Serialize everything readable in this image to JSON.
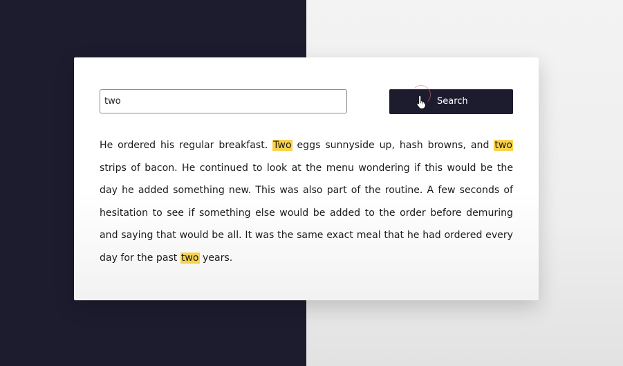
{
  "search": {
    "value": "two",
    "button_label": "Search"
  },
  "paragraph": {
    "segments": [
      {
        "text": "He ordered his regular breakfast. ",
        "highlight": false
      },
      {
        "text": "Two",
        "highlight": true
      },
      {
        "text": " eggs sunnyside up, hash browns, and ",
        "highlight": false
      },
      {
        "text": "two",
        "highlight": true
      },
      {
        "text": " strips of bacon. He continued to look at the menu wondering if this would be the day he added something new. This was also part of the routine. A few seconds of hesitation to see if something else would be added to the order before demuring and saying that would be all. It was the same exact meal that he had ordered every day for the past ",
        "highlight": false
      },
      {
        "text": "two",
        "highlight": true
      },
      {
        "text": " years.",
        "highlight": false
      }
    ]
  },
  "colors": {
    "dark_background": "#1d1c2f",
    "light_background": "#f0f0f0",
    "highlight": "#f8d24a",
    "button_background": "#1d1c2f"
  },
  "icons": {
    "cursor": "hand-pointer-icon"
  }
}
